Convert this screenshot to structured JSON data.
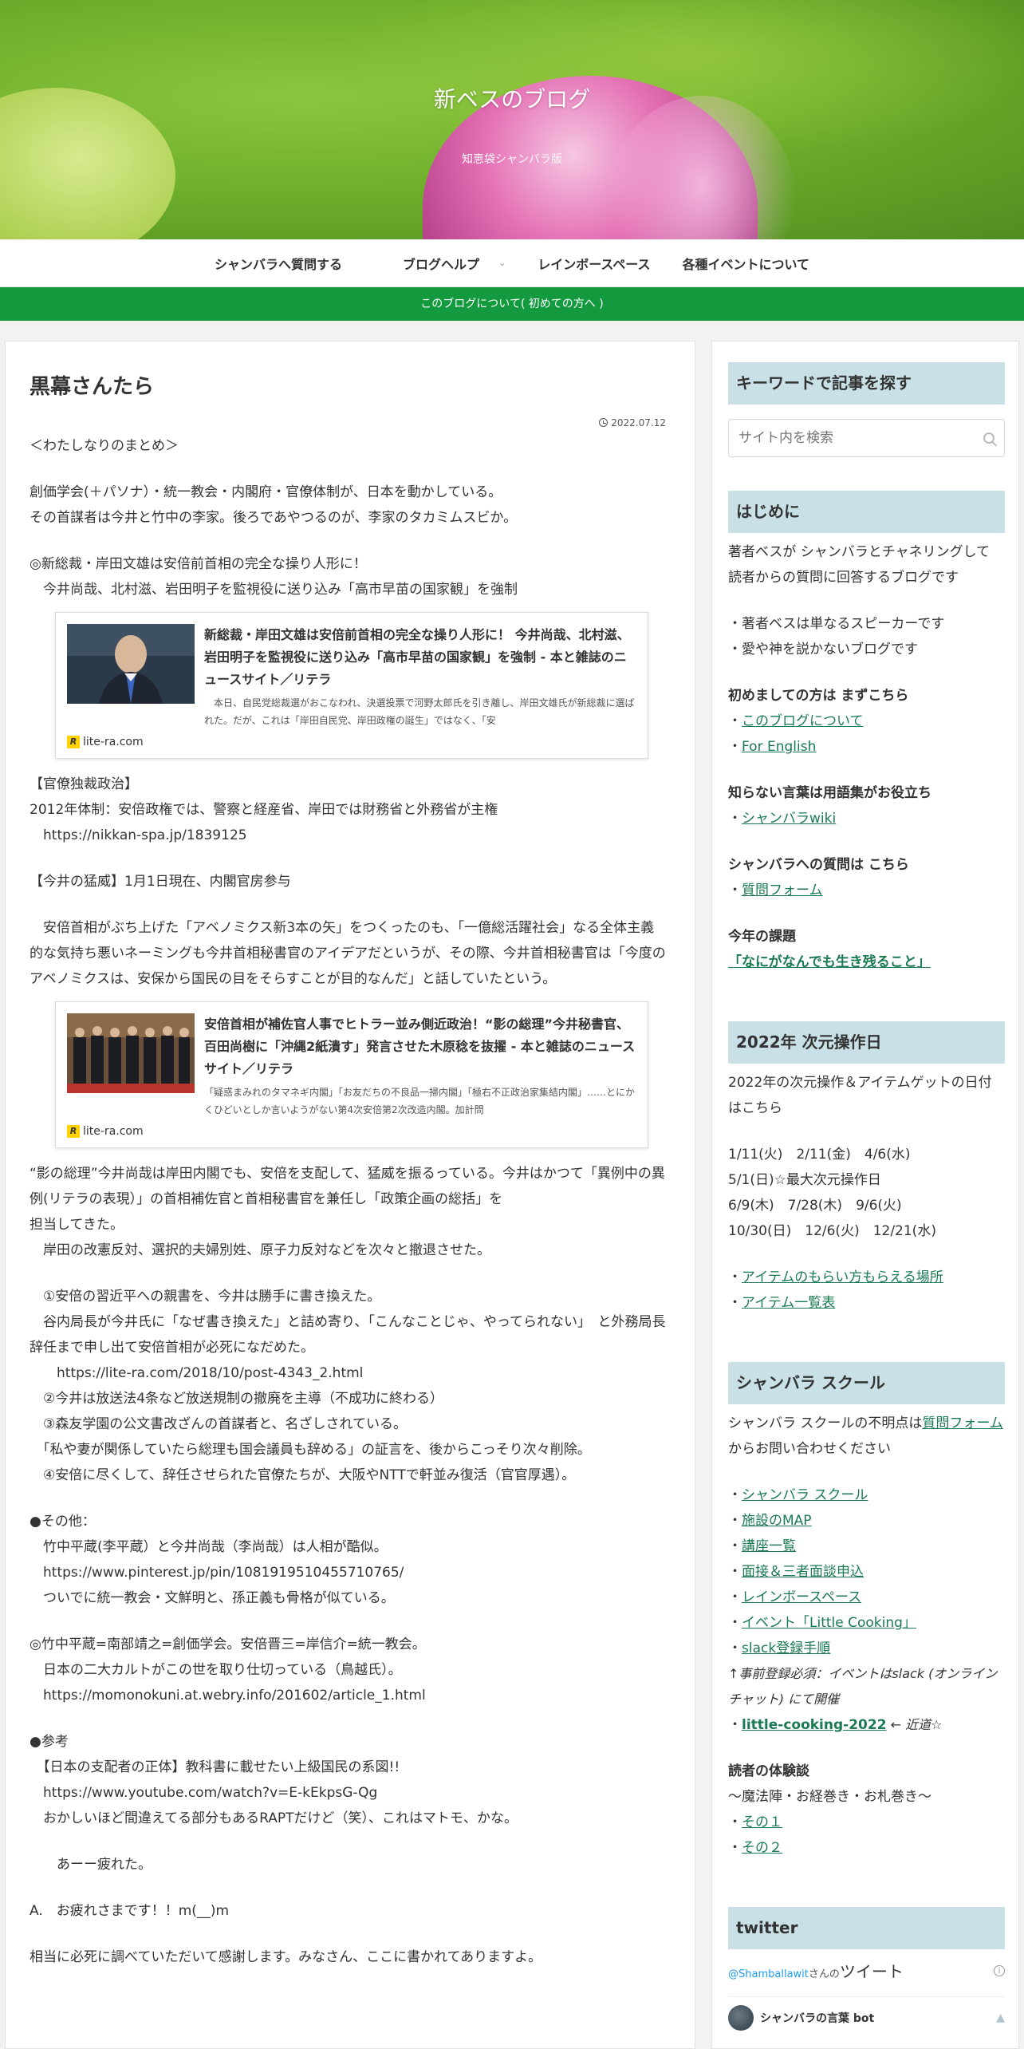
{
  "header": {
    "site_title": "新ベスのブログ",
    "tagline": "知恵袋シャンバラ版"
  },
  "nav": {
    "items": [
      "シャンバラへ質問する",
      "ブログヘルプ",
      "レインボースペース",
      "各種イベントについて"
    ],
    "notice": "このブログについて( 初めての方へ )"
  },
  "article": {
    "title": "黒幕さんたら",
    "date": "2022.07.12",
    "p1": "＜わたしなりのまとめ＞",
    "p2": "創価学会(＋パソナ）・統一教会・内閣府・官僚体制が、日本を動かしている。\nその首謀者は今井と竹中の李家。後ろであやつるのが、李家のタカミムスビか。",
    "p3": "◎新総裁・岸田文雄は安倍前首相の完全な操り人形に！\n　今井尚哉、北村滋、岩田明子を監視役に送り込み「高市早苗の国家観」を強制",
    "card1": {
      "title": "新総裁・岸田文雄は安倍前首相の完全な操り人形に！ 今井尚哉、北村滋、岩田明子を監視役に送り込み「高市早苗の国家観」を強制 - 本と雑誌のニュースサイト／リテラ",
      "snippet": "　本日、自民党総裁選がおこなわれ、決選投票で河野太郎氏を引き離し、岸田文雄氏が新総裁に選ばれた。だが、これは「岸田自民党、岸田政権の誕生」ではなく、「安",
      "source": "lite-ra.com"
    },
    "p4": "【官僚独裁政治】\n2012年体制：安倍政権では、警察と経産省、岸田では財務省と外務省が主権\n　https://nikkan-spa.jp/1839125",
    "p5": "【今井の猛威】1月1日現在、内閣官房参与",
    "p6": "　安倍首相がぶち上げた「アベノミクス新3本の矢」をつくったのも、「一億総活躍社会」なる全体主義的な気持ち悪いネーミングも今井首相秘書官のアイデアだというが、その際、今井首相秘書官は「今度のアベノミクスは、安保から国民の目をそらすことが目的なんだ」と話していたという。",
    "card2": {
      "title": "安倍首相が補佐官人事でヒトラー並み側近政治！“影の総理”今井秘書官、百田尚樹に「沖縄2紙潰す」発言させた木原稔を抜擢 - 本と雑誌のニュースサイト／リテラ",
      "snippet": "「疑惑まみれのタマネギ内閣」「お友だちの不良品一掃内閣」「極右不正政治家集結内閣」……とにかくひどいとしか言いようがない第4次安倍第2次改造内閣。加計問",
      "source": "lite-ra.com"
    },
    "p7": "“影の総理”今井尚哉は岸田内閣でも、安倍を支配して、猛威を振るっている。今井はかつて「異例中の異例(リテラの表現）」の首相補佐官と首相秘書官を兼任し「政策企画の総括」を\n担当してきた。\n　岸田の改憲反対、選択的夫婦別姓、原子力反対などを次々と撤退させた。",
    "p8": "　①安倍の習近平への親書を、今井は勝手に書き換えた。\n　谷内局長が今井氏に「なぜ書き換えた」と詰め寄り、「こんなことじゃ、やってられない」　と外務局長辞任まで申し出て安倍首相が必死になだめた。\n　　https://lite-ra.com/2018/10/post-4343_2.html\n　②今井は放送法4条など放送規制の撤廃を主導（不成功に終わる）\n　③森友学園の公文書改ざんの首謀者と、名ざしされている。\n　「私や妻が関係していたら総理も国会議員も辞める」の証言を、後からこっそり次々削除。\n　④安倍に尽くして、辞任させられた官僚たちが、大阪やNTTで軒並み復活（官官厚遇）。",
    "p9": "●その他：\n　竹中平蔵(李平蔵）と今井尚哉（李尚哉）は人相が酷似。\n　https://www.pinterest.jp/pin/1081919510455710765/\n　ついでに統一教会・文鮮明と、孫正義も骨格が似ている。",
    "p10": "◎竹中平蔵=南部靖之=創価学会。安倍晋三=岸信介=統一教会。\n　日本の二大カルトがこの世を取り仕切っている（鳥越氏）。\n　https://momonokuni.at.webry.info/201602/article_1.html",
    "p11": "●参考\n　【日本の支配者の正体】教科書に載せたい上級国民の系図!!\n　https://www.youtube.com/watch?v=E-kEkpsG-Qg\n　おかしいほど間違えてる部分もあるRAPTだけど（笑）、これはマトモ、かな。",
    "p12": "　　あーー疲れた。",
    "p13": "A.　お疲れさまです！！m(__)m",
    "p14": "相当に必死に調べていただいて感謝します。みなさん、ここに書かれてありますよ。"
  },
  "sidebar": {
    "search": {
      "heading": "キーワードで記事を探す",
      "placeholder": "サイト内を検索"
    },
    "intro": {
      "heading": "はじめに",
      "line1": "著者ベスが シャンバラとチャネリングして 読者からの質問に回答するブログです",
      "line2": "・著者ベスは単なるスピーカーです",
      "line3": "・愛や神を説かないブログです",
      "first_title": "初めましての方は まずこちら",
      "link_about": "このブログについて",
      "link_english": "For English",
      "glossary_title": "知らない言葉は用語集がお役立ち",
      "link_wiki": "シャンバラwiki",
      "question_title": "シャンバラへの質問は こちら",
      "link_form": "質問フォーム",
      "theme_title": "今年の課題",
      "theme_text": "「なにがなんでも生き残ること」"
    },
    "ops": {
      "heading": "2022年 次元操作日",
      "desc": "2022年の次元操作＆アイテムゲットの日付はこちら",
      "dates1": "1/11(火)　2/11(金)　4/6(水)",
      "dates2": "5/1(日)☆最大次元操作日",
      "dates3": "6/9(木)　7/28(木)　9/6(火)",
      "dates4": "10/30(日)　12/6(火)　12/21(水)",
      "link_items": "アイテムのもらい方もらえる場所",
      "link_list": "アイテム一覧表"
    },
    "school": {
      "heading": "シャンバラ スクール",
      "desc_pre": "シャンバラ スクールの不明点は",
      "desc_link": "質問フォーム",
      "desc_post": "からお問い合わせください",
      "links": [
        "シャンバラ スクール",
        "施設のMAP",
        "講座一覧",
        "面接＆三者面談申込",
        "レインボースペース",
        "イベント「Little Cooking」",
        "slack登録手順"
      ],
      "note": "↑事前登録必須：イベントはslack (オンラインチャット) にて開催",
      "cooking": "little-cooking-2022",
      "soon": " ← 近道☆"
    },
    "exp": {
      "title": "読者の体験談",
      "sub": "〜魔法陣・お経巻き・お札巻き〜",
      "link1": "その１",
      "link2": "その２"
    },
    "twitter": {
      "heading": "twitter",
      "handle": "@Shamballawit",
      "handle_suffix": "さんの",
      "tweet_label": "ツイート",
      "bot_name": "シャンバラの言葉 bot"
    }
  }
}
